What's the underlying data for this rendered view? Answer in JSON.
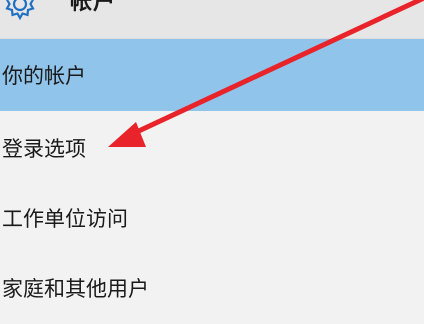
{
  "header": {
    "title": "帐户",
    "icon": "gear-icon"
  },
  "sidebar": {
    "items": [
      {
        "label": "你的帐户",
        "selected": true
      },
      {
        "label": "登录选项",
        "selected": false
      },
      {
        "label": "工作单位访问",
        "selected": false
      },
      {
        "label": "家庭和其他用户",
        "selected": false
      }
    ]
  },
  "colors": {
    "selected_bg": "#91c4ea",
    "header_bg": "#e6e6e6",
    "page_bg": "#f2f2f2",
    "annotation_arrow": "#e8232a"
  }
}
